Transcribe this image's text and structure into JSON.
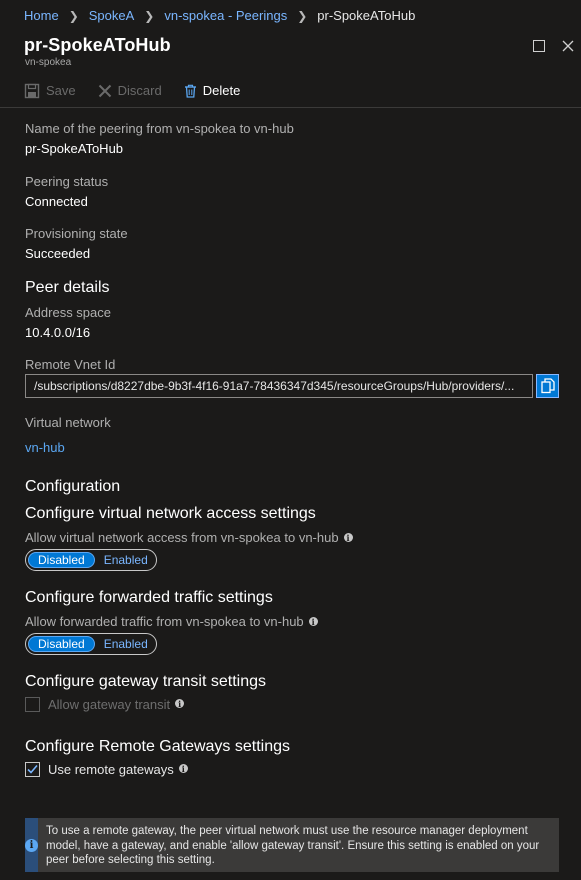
{
  "breadcrumb": {
    "items": [
      "Home",
      "SpokeA",
      "vn-spokea - Peerings"
    ],
    "current": "pr-SpokeAToHub"
  },
  "header": {
    "title": "pr-SpokeAToHub",
    "subtitle": "vn-spokea"
  },
  "toolbar": {
    "save_label": "Save",
    "discard_label": "Discard",
    "delete_label": "Delete"
  },
  "fields": {
    "peering_name_label": "Name of the peering from vn-spokea to vn-hub",
    "peering_name_value": "pr-SpokeAToHub",
    "peering_status_label": "Peering status",
    "peering_status_value": "Connected",
    "provisioning_state_label": "Provisioning state",
    "provisioning_state_value": "Succeeded"
  },
  "peer_details": {
    "title": "Peer details",
    "address_space_label": "Address space",
    "address_space_value": "10.4.0.0/16",
    "remote_vnet_id_label": "Remote Vnet Id",
    "remote_vnet_id_value": "/subscriptions/d8227dbe-9b3f-4f16-91a7-78436347d345/resourceGroups/Hub/providers/...",
    "virtual_network_label": "Virtual network",
    "virtual_network_value": "vn-hub"
  },
  "configuration": {
    "title": "Configuration",
    "vnet_access": {
      "title": "Configure virtual network access settings",
      "description": "Allow virtual network access from vn-spokea to vn-hub",
      "options": [
        "Disabled",
        "Enabled"
      ],
      "selected": "Disabled"
    },
    "forwarded_traffic": {
      "title": "Configure forwarded traffic settings",
      "description": "Allow forwarded traffic from vn-spokea to vn-hub",
      "options": [
        "Disabled",
        "Enabled"
      ],
      "selected": "Disabled"
    },
    "gateway_transit": {
      "title": "Configure gateway transit settings",
      "checkbox_label": "Allow gateway transit",
      "checked": false,
      "disabled": true
    },
    "remote_gateways": {
      "title": "Configure Remote Gateways settings",
      "checkbox_label": "Use remote gateways",
      "checked": true
    }
  },
  "info_box": {
    "text": "To use a remote gateway, the peer virtual network must use the resource manager deployment model, have a gateway, and enable 'allow gateway transit'. Ensure this setting is enabled on your peer before selecting this setting."
  },
  "colors": {
    "background": "#1b1a19",
    "accent": "#0078d4",
    "link": "#5ba7f2",
    "info_strip": "#2b4e7a"
  },
  "icons": {
    "save": "save-icon",
    "discard": "close-x-icon",
    "delete": "trash-icon",
    "maximize": "maximize-icon",
    "close": "close-icon",
    "copy": "copy-icon",
    "info": "info-icon",
    "checkmark": "checkmark-icon"
  }
}
